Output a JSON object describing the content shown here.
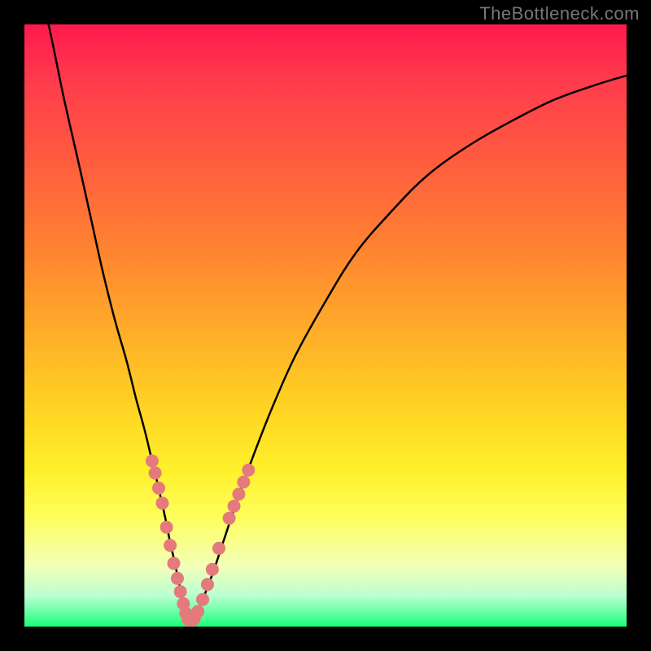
{
  "watermark": "TheBottleneck.com",
  "colors": {
    "background_black": "#000000",
    "gradient_top": "#ff1a4d",
    "gradient_bottom": "#1aff7a",
    "curve": "#000000",
    "marker": "#e47a7c"
  },
  "chart_data": {
    "type": "line",
    "title": "",
    "xlabel": "",
    "ylabel": "",
    "xlim": [
      0,
      100
    ],
    "ylim": [
      0,
      100
    ],
    "grid": false,
    "legend": false,
    "series": [
      {
        "name": "left-branch",
        "x_percent": [
          4.0,
          6.5,
          9.0,
          11.0,
          13.0,
          15.0,
          17.0,
          18.5,
          20.0,
          21.2,
          22.4,
          23.4,
          24.2,
          25.0,
          25.6,
          26.2,
          26.8,
          27.3
        ],
        "y_percent": [
          100.0,
          88.0,
          77.0,
          68.0,
          59.0,
          51.0,
          44.0,
          38.0,
          32.5,
          27.5,
          22.5,
          18.0,
          14.0,
          10.5,
          7.5,
          5.0,
          3.0,
          1.5
        ]
      },
      {
        "name": "right-branch",
        "x_percent": [
          28.0,
          29.0,
          30.2,
          31.5,
          33.0,
          35.0,
          37.5,
          41.0,
          45.0,
          50.0,
          55.0,
          61.0,
          67.0,
          74.0,
          81.0,
          88.0,
          95.0,
          100.0
        ],
        "y_percent": [
          1.0,
          3.0,
          6.0,
          9.5,
          14.0,
          20.0,
          27.0,
          36.0,
          45.0,
          54.0,
          62.0,
          69.0,
          75.0,
          80.0,
          84.0,
          87.5,
          90.0,
          91.5
        ]
      }
    ],
    "valley_min": {
      "x_percent": 27.5,
      "y_percent": 0.5
    },
    "markers": {
      "name": "salmon-dots",
      "color": "#e47a7c",
      "radius_px": 8,
      "points": [
        {
          "x_percent": 21.2,
          "y_percent": 27.5
        },
        {
          "x_percent": 21.7,
          "y_percent": 25.5
        },
        {
          "x_percent": 22.3,
          "y_percent": 23.0
        },
        {
          "x_percent": 22.9,
          "y_percent": 20.5
        },
        {
          "x_percent": 23.6,
          "y_percent": 16.5
        },
        {
          "x_percent": 24.2,
          "y_percent": 13.5
        },
        {
          "x_percent": 24.8,
          "y_percent": 10.5
        },
        {
          "x_percent": 25.4,
          "y_percent": 8.0
        },
        {
          "x_percent": 25.9,
          "y_percent": 5.8
        },
        {
          "x_percent": 26.4,
          "y_percent": 3.8
        },
        {
          "x_percent": 26.8,
          "y_percent": 2.2
        },
        {
          "x_percent": 27.2,
          "y_percent": 1.2
        },
        {
          "x_percent": 27.6,
          "y_percent": 0.6
        },
        {
          "x_percent": 28.2,
          "y_percent": 1.3
        },
        {
          "x_percent": 28.8,
          "y_percent": 2.5
        },
        {
          "x_percent": 29.6,
          "y_percent": 4.5
        },
        {
          "x_percent": 30.4,
          "y_percent": 7.0
        },
        {
          "x_percent": 31.2,
          "y_percent": 9.5
        },
        {
          "x_percent": 32.3,
          "y_percent": 13.0
        },
        {
          "x_percent": 34.0,
          "y_percent": 18.0
        },
        {
          "x_percent": 34.8,
          "y_percent": 20.0
        },
        {
          "x_percent": 35.6,
          "y_percent": 22.0
        },
        {
          "x_percent": 36.4,
          "y_percent": 24.0
        },
        {
          "x_percent": 37.2,
          "y_percent": 26.0
        }
      ]
    }
  }
}
